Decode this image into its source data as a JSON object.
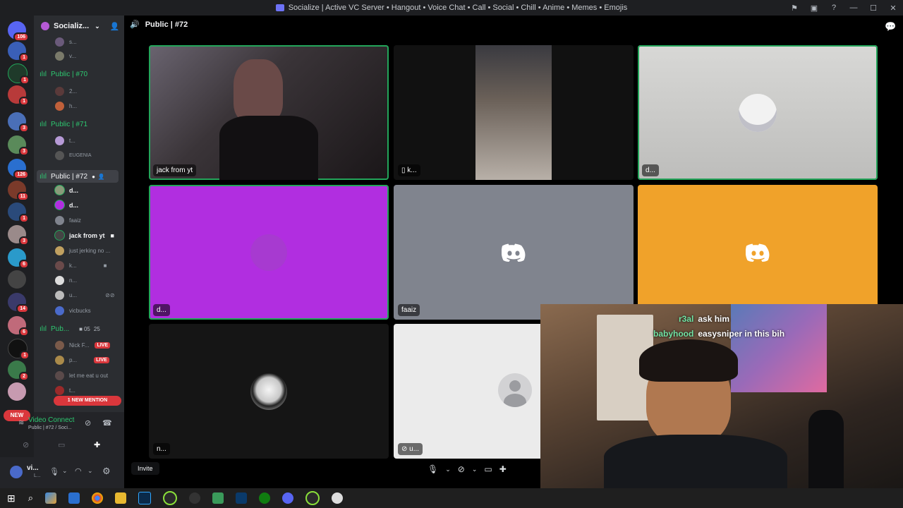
{
  "window": {
    "title": "Socialize | Active VC Server • Hangout • Voice Chat • Call • Social • Chill • Anime • Memes • Emojis"
  },
  "guilds": [
    {
      "badge": "106",
      "color": "#5865f2"
    },
    {
      "badge": "1",
      "color": "#3a5fb7"
    },
    {
      "badge": "1",
      "color": "#23a55a"
    },
    {
      "badge": "1",
      "color": "#b83a3a"
    },
    {
      "badge": "3",
      "color": "#4a6fb7"
    },
    {
      "badge": "3",
      "color": "#5a8a5a"
    },
    {
      "badge": "126",
      "color": "#2a6fcf"
    },
    {
      "badge": "11",
      "color": "#7a3a2a"
    },
    {
      "badge": "1",
      "color": "#2a4a7a"
    },
    {
      "badge": "3",
      "color": "#9a8a8a"
    },
    {
      "badge": "6",
      "color": "#2a9aca"
    },
    {
      "badge": "",
      "color": "#444"
    },
    {
      "badge": "14",
      "color": "#3a3a6a"
    },
    {
      "badge": "6",
      "color": "#c06a7a"
    },
    {
      "badge": "1",
      "color": "#111"
    },
    {
      "badge": "2",
      "color": "#3a7a4a"
    },
    {
      "badge": "",
      "color": "#c79ab0"
    }
  ],
  "guild_new_label": "NEW",
  "server": {
    "name": "Socializ..."
  },
  "channels": {
    "top_members": [
      "s...",
      "v..."
    ],
    "ch70": {
      "name": "Public | #70",
      "members": [
        "2...",
        "h..."
      ]
    },
    "ch71": {
      "name": "Public | #71",
      "members": [
        "t...",
        "EUGENIA"
      ]
    },
    "ch72": {
      "name": "Public | #72",
      "members": [
        "d...",
        "d...",
        "faaiz",
        "jack from yt",
        "just jerking no ...",
        "k...",
        "n...",
        "u...",
        "vicbucks"
      ]
    },
    "ch_pub": {
      "name": "Pub...",
      "video_count": "05",
      "user_count": "25",
      "members": [
        "Nick F...",
        "p...",
        "let me eat u out",
        "t..."
      ],
      "live_label": "LIVE"
    },
    "mention_pill": "1 NEW MENTION"
  },
  "voice_panel": {
    "status": "Video Connected",
    "channel": "Public | #72 / Soci..."
  },
  "user_panel": {
    "name": "vi...",
    "status": "L..."
  },
  "main": {
    "header": "Public | #72",
    "invite_label": "Invite",
    "tiles": [
      {
        "name": "jack from yt",
        "bg": "#2a2628"
      },
      {
        "name": "k...",
        "bg": "#111111"
      },
      {
        "name": "d...",
        "bg": "#cfcfcf"
      },
      {
        "name": "d...",
        "bg": "#b12ee0"
      },
      {
        "name": "faaiz",
        "bg": "#80848e"
      },
      {
        "name": "",
        "bg": "#f0a22a"
      },
      {
        "name": "n...",
        "bg": "#151515"
      },
      {
        "name": "u...",
        "bg": "#ebebeb"
      }
    ]
  },
  "webcam_chat": [
    {
      "user": "r3al",
      "text": "ask him"
    },
    {
      "user": "babyhood",
      "text": "easysniper in this bih"
    }
  ],
  "colors": {
    "discord_blurple": "#5865f2",
    "voice_green": "#23a55a",
    "live_red": "#da373c"
  }
}
